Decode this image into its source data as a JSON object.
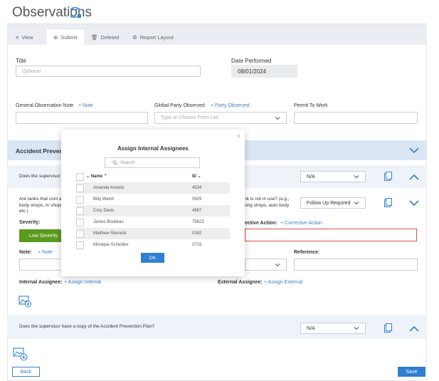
{
  "page": {
    "title": "Observations"
  },
  "tabs": [
    {
      "label": "View"
    },
    {
      "label": "Submit"
    },
    {
      "label": "Deleted"
    },
    {
      "label": "Report Layout"
    }
  ],
  "form": {
    "title_label": "Title",
    "title_placeholder": "Optional",
    "date_label": "Date Performed",
    "date_value": "08/01/2024",
    "general_note_label": "General Observation Note",
    "note_link": "+ Note",
    "global_party_label": "Global Party Observed",
    "party_link": "+ Party Observed",
    "party_placeholder": "Type or Choose From List",
    "permit_label": "Permit To Work"
  },
  "section": {
    "title": "Accident Prevent",
    "q1_text": "Does the supervisor",
    "q1_value": "N/A",
    "q2_text_left": "Are tanks that cont auto body shops, m shops, etc.)",
    "q2_text_right": "nk is not in use? (e.g., king shops, auto body",
    "q2_value": "Follow Up Required",
    "severity_label": "Severity:",
    "severity_value": "Low Severity",
    "corrective_label": "ective Action:",
    "corrective_link": "+ Corrective Action",
    "note_label": "Note:",
    "note_link": "+ Note",
    "reference_label": "Reference:",
    "internal_assignee_label": "Internal Assignee:",
    "assign_internal_link": "+ Assign Internal",
    "external_assignee_label": "External Assignee:",
    "assign_external_link": "+ Assign External",
    "q3_text": "Does the supervisor have a copy of the Accident Prevention Plan?",
    "q3_value": "N/A"
  },
  "footer": {
    "back_label": "Back",
    "save_label": "Save"
  },
  "modal": {
    "title": "Assign Internal Assignees",
    "close": "×",
    "search_placeholder": "Search",
    "col_name": "Name",
    "col_id": "ID",
    "rows": [
      {
        "name": "Amanda Arreola",
        "id": "4534"
      },
      {
        "name": "Billy Welch",
        "id": "0929"
      },
      {
        "name": "Cory Davis",
        "id": "4567"
      },
      {
        "name": "James Bouileau",
        "id": "75623"
      },
      {
        "name": "Matthew Stelnicki",
        "id": "0192"
      },
      {
        "name": "Monique Scheidler",
        "id": "0715"
      }
    ],
    "ok_label": "OK"
  },
  "colors": {
    "accent": "#2f80d1",
    "section": "#dae6f3",
    "green": "#5a9a1c",
    "danger": "#d9534f"
  }
}
